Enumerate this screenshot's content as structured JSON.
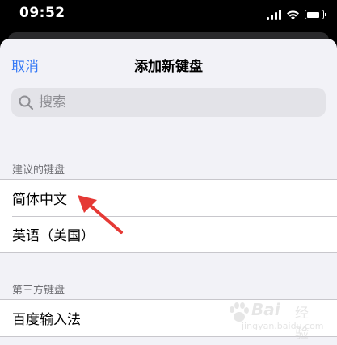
{
  "status_bar": {
    "time": "09:52",
    "battery_level": 0.85,
    "icons": [
      "signal-icon",
      "wifi-icon",
      "battery-icon"
    ]
  },
  "nav": {
    "cancel_label": "取消",
    "title": "添加新键盘"
  },
  "search": {
    "placeholder": "搜索"
  },
  "sections": {
    "suggested": {
      "header": "建议的键盘",
      "items": [
        {
          "label": "简体中文"
        },
        {
          "label": "英语（美国）"
        }
      ]
    },
    "third_party": {
      "header": "第三方键盘",
      "items": [
        {
          "label": "百度输入法"
        }
      ]
    }
  },
  "watermark": {
    "brand": "Bai",
    "suffix": "经验",
    "url": "jingyan.baidu.com"
  },
  "colors": {
    "accent": "#3478f6",
    "arrow": "#e53935",
    "background": "#f2f2f7"
  }
}
